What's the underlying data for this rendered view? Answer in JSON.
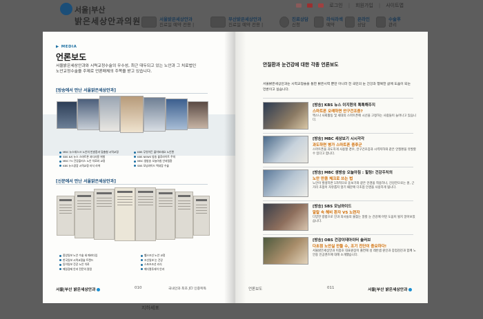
{
  "site": {
    "logo_line1": "서울|부산",
    "logo_line2": "밝은세상안과의원",
    "top_links": [
      "로그인",
      "회원가입",
      "사이트맵"
    ],
    "nav": [
      {
        "title": "서울밝은세상안과",
        "sub": "진료일 예약 전용 |"
      },
      {
        "title": "부산밝은세상안과",
        "sub": "진료일 예약 전용 |"
      },
      {
        "title": "진료상담",
        "sub": "신청"
      },
      {
        "title": "라식라섹",
        "sub": "예약"
      },
      {
        "title": "온라인",
        "sub": "상담"
      },
      {
        "title": "수술후",
        "sub": "관리"
      }
    ],
    "footer_text": "지하세포"
  },
  "brochure": {
    "left": {
      "tag": "MEDIA",
      "title": "언론보도",
      "intro": "서울밝은세상안과와 시력교정수술의 우수성, 최근 대두되고 있는 노안과 그 치료법인 노안교정수술을 주제로 언론매체의 주목을 받고 있습니다.",
      "broadcast_heading": "[방송에서 만난 서울밝은세상안과]",
      "newspaper_heading": "[신문에서 만난 서울밝은세상안과]",
      "broadcast_legend_left": [
        "MBC 뉴스데스크 노안의 빈발증과 맞춤형 시력교정",
        "SBS 8시 뉴스 스마트폰 과다사용 위험",
        "MBC TV 건강플러스 노안 치료와 교정",
        "KBS 뉴스광장 시력교정 라식 라섹"
      ],
      "broadcast_legend_right": [
        "KBS 무엇이든 물어보세요 노안편",
        "KBS NEWS 방송 블루라이트 주의",
        "MBC 생방송 오늘아침 안과질환",
        "SBS 모닝와이드 백내장 수술"
      ],
      "newspaper_legend_left": [
        "중앙일보 노안 수술 새 패러다임",
        "한국일보 시력교정술 트렌드",
        "동아일보 건강 노안 치료",
        "매일경제 안과 전문의 칼럼"
      ],
      "newspaper_legend_right": [
        "헬스조선 노안 교정",
        "조선일보 눈 건강",
        "스포츠조선 라식",
        "메디컬투데이 안과"
      ],
      "footer_logo": "서울|부산 밝은세상안과",
      "page_no": "010",
      "footer_note": "국내안과 최초 JCI 인증획득"
    },
    "right": {
      "title": "안질환과 눈건강에 대한 각종 언론보도",
      "intro": "서울밝은세상안과는 시력교정술을 통한 밝은시력 뿐만 아니라 전 국민의 눈 건강과 행복한 삶에 도움이 되는 언론이고 싶습니다.",
      "items": [
        {
          "channel": "[방송] KBS 뉴스 이지현의 톡톡해주지",
          "headline": "스마트폰 오래하면 안구건조증?",
          "desc": "엑스나 사회활동 및 세대의 스마트폰에 시선을 고정하는 사람들이 늘어나고 있습니다."
        },
        {
          "channel": "[방송] MBC 세상보기 시시각각",
          "headline": "과도하면 병가 스마트폰 중후군",
          "desc": "스마트폰을 과도하게 사용할 경우, 안구건조증과 시력저하와 같은 안질환을 유발할 수 있다고 합니다."
        },
        {
          "channel": "[방송] MBC 생방송 오늘아침 : 힐링! 건강주치의",
          "headline": "노안 만큼 체크로 쓰는 법",
          "desc": "노안이 발생하면 1차적으로 돋보기와 같은 안경을 착용하나, 건강한으로는 원, 근거리 초점이 자유롭지 않기 때문에 다초점 안경을 사용하게 됩니다."
        },
        {
          "channel": "[방송] SBS 모닝와이드",
          "headline": "알칼 속 해비 환자 VS 노련자",
          "desc": "다양한 방법으로 안과 의사들의 물찾는 알칼 눈 건강에 어떤 도움이 될지 알아보았습니다."
        },
        {
          "channel": "[방송] OBS 건강이데아이터 솔러브",
          "headline": "다초점 노안실 만들 수, 조기 진단이 중요하다!",
          "desc": "서울밝은세상안과 이종호 대표원장이 출연해 성 레반샘 원인과 증험검진과 함께 노안용 인공렌즈에 대해 소개했습니다."
        }
      ],
      "footer_label": "언론보도",
      "page_no": "011",
      "footer_logo": "서울|부산 밝은세상안과"
    }
  }
}
